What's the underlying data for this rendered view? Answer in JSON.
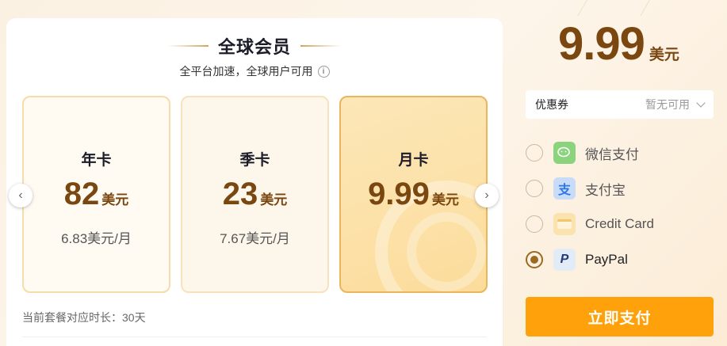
{
  "header": {
    "title": "全球会员",
    "subtitle": "全平台加速，全球用户可用"
  },
  "plans": [
    {
      "name": "年卡",
      "price": "82",
      "unit": "美元",
      "monthly": "6.83美元/月",
      "selected": false
    },
    {
      "name": "季卡",
      "price": "23",
      "unit": "美元",
      "monthly": "7.67美元/月",
      "selected": false
    },
    {
      "name": "月卡",
      "price": "9.99",
      "unit": "美元",
      "selected": true
    }
  ],
  "duration_text": "当前套餐对应时长：30天",
  "summary": {
    "price": "9.99",
    "unit": "美元"
  },
  "coupon": {
    "label": "优惠券",
    "status": "暂无可用"
  },
  "payment_methods": [
    {
      "label": "微信支付",
      "icon": "wechat-icon",
      "selected": false
    },
    {
      "label": "支付宝",
      "icon": "alipay-icon",
      "selected": false
    },
    {
      "label": "Credit Card",
      "icon": "credit-card-icon",
      "selected": false
    },
    {
      "label": "PayPal",
      "icon": "paypal-icon",
      "selected": true
    }
  ],
  "pay_button": "立即支付",
  "colors": {
    "accent": "#ffa10a",
    "price_brown": "#7a4710",
    "selected_border": "#e9b65c"
  }
}
